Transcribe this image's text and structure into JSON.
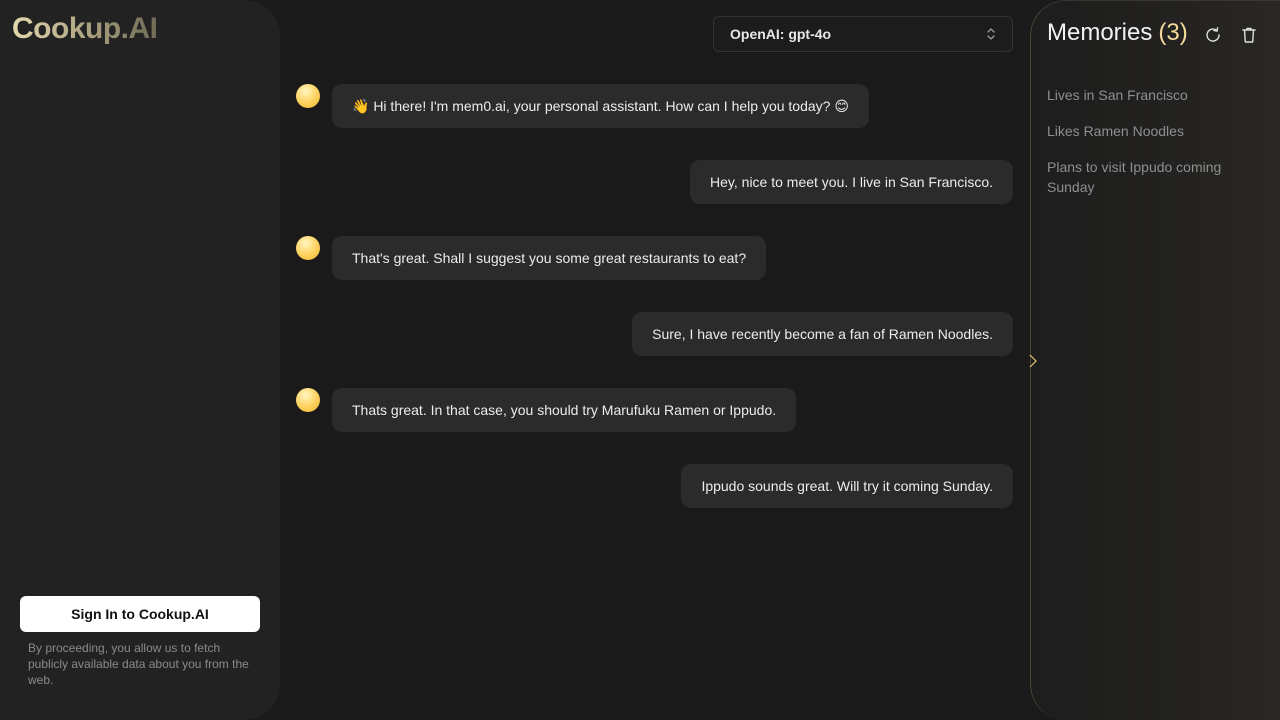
{
  "app": {
    "logo": "Cookup.AI"
  },
  "sidebar": {
    "signin_label": "Sign In to Cookup.AI",
    "disclaimer": "By proceeding, you allow us to fetch publicly available data about you from the web."
  },
  "model_selector": {
    "selected": "OpenAI: gpt-4o",
    "icon": "chevron-up-down-icon"
  },
  "chat": {
    "messages": [
      {
        "role": "assistant",
        "text": "👋 Hi there! I'm mem0.ai, your personal assistant. How can I help you today? 😊"
      },
      {
        "role": "user",
        "text": "Hey, nice to meet you. I live in San Francisco."
      },
      {
        "role": "assistant",
        "text": "That's great. Shall I suggest you some great restaurants to eat?"
      },
      {
        "role": "user",
        "text": "Sure, I have recently become a fan of Ramen Noodles."
      },
      {
        "role": "assistant",
        "text": "Thats great. In that case, you should try Marufuku Ramen or Ippudo."
      },
      {
        "role": "user",
        "text": "Ippudo sounds great. Will try it coming Sunday."
      }
    ]
  },
  "memories": {
    "title": "Memories",
    "count": "(3)",
    "refresh_icon": "refresh-icon",
    "delete_icon": "trash-icon",
    "items": [
      "Lives in San Francisco",
      "Likes Ramen Noodles",
      "Plans to visit Ippudo coming Sunday"
    ]
  },
  "colors": {
    "background": "#1a1a1a",
    "bubble": "#2b2b2b",
    "accent": "#f3d99a"
  }
}
